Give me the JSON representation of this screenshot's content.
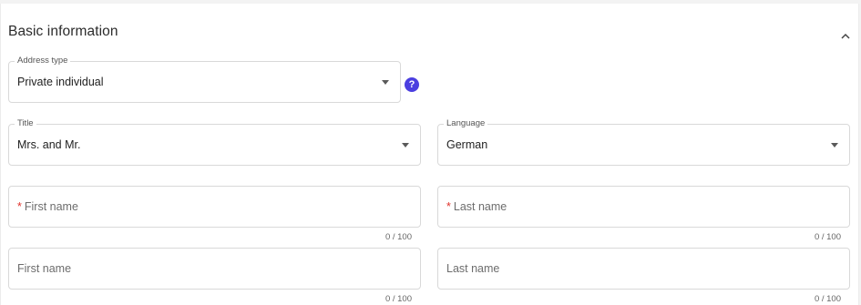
{
  "section": {
    "title": "Basic information"
  },
  "address_type": {
    "label": "Address type",
    "value": "Private individual"
  },
  "help": {
    "glyph": "?"
  },
  "title_field": {
    "label": "Title",
    "value": "Mrs. and Mr."
  },
  "language": {
    "label": "Language",
    "value": "German"
  },
  "first_name_1": {
    "required_marker": "*",
    "placeholder": "First name",
    "counter": "0 / 100"
  },
  "last_name_1": {
    "required_marker": "*",
    "placeholder": "Last name",
    "counter": "0 / 100"
  },
  "first_name_2": {
    "placeholder": "First name",
    "counter": "0 / 100"
  },
  "last_name_2": {
    "placeholder": "Last name",
    "counter": "0 / 100"
  },
  "colors": {
    "accent": "#4b3fe0",
    "required": "#e0322b",
    "border": "#d9d9d9"
  },
  "icons": {
    "collapse": "chevron-up-icon",
    "help": "help-icon",
    "dropdown": "caret-down-icon"
  }
}
